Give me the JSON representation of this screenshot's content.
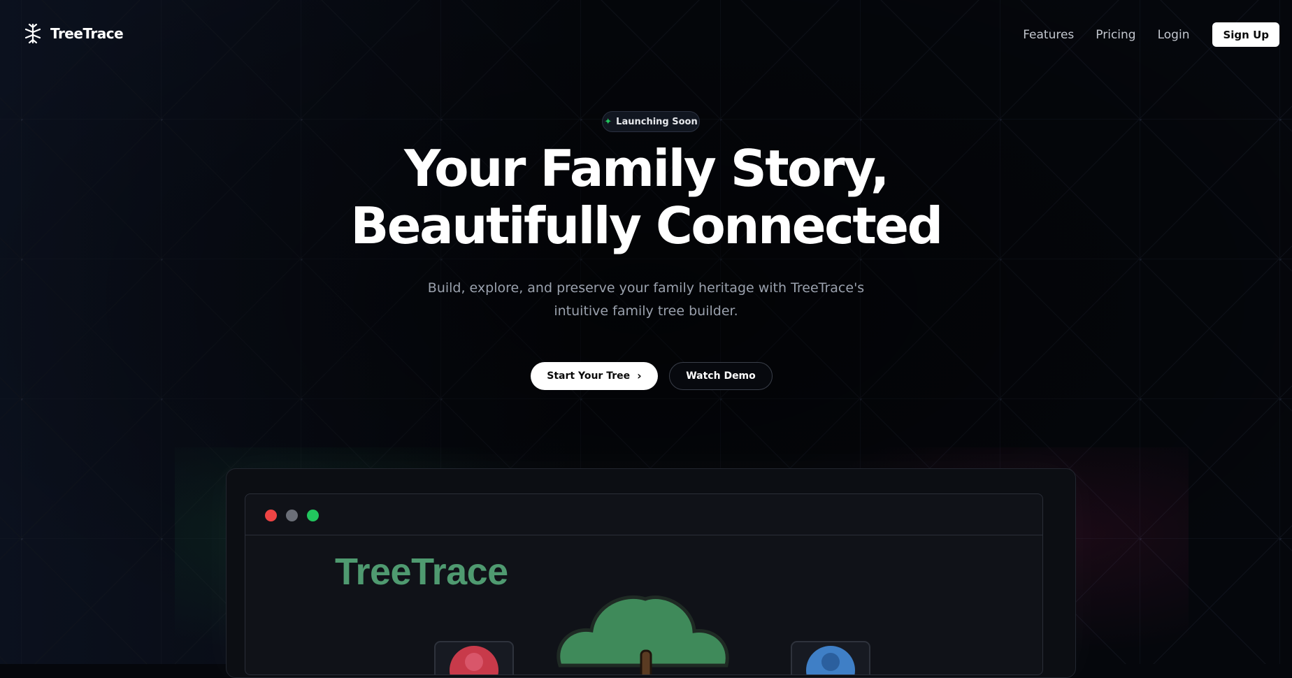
{
  "header": {
    "brand_name": "TreeTrace",
    "nav_links": [
      "Features",
      "Pricing",
      "Login"
    ],
    "signup_label": "Sign Up"
  },
  "hero": {
    "badge_icon": "sparkle-icon",
    "badge_label": "Launching Soon",
    "title_lines": [
      "Your Family Story,",
      "Beautifully Connected"
    ],
    "subtitle": "Build, explore, and preserve your family heritage with TreeTrace's intuitive family tree builder.",
    "primary_cta": "Start Your Tree",
    "secondary_cta": "Watch Demo"
  },
  "preview": {
    "app_title": "TreeTrace"
  },
  "colors": {
    "background": "#05070c",
    "accent_green": "#22c55e",
    "tree_green": "#3f8a5a",
    "app_title_green": "#4f9a70"
  }
}
